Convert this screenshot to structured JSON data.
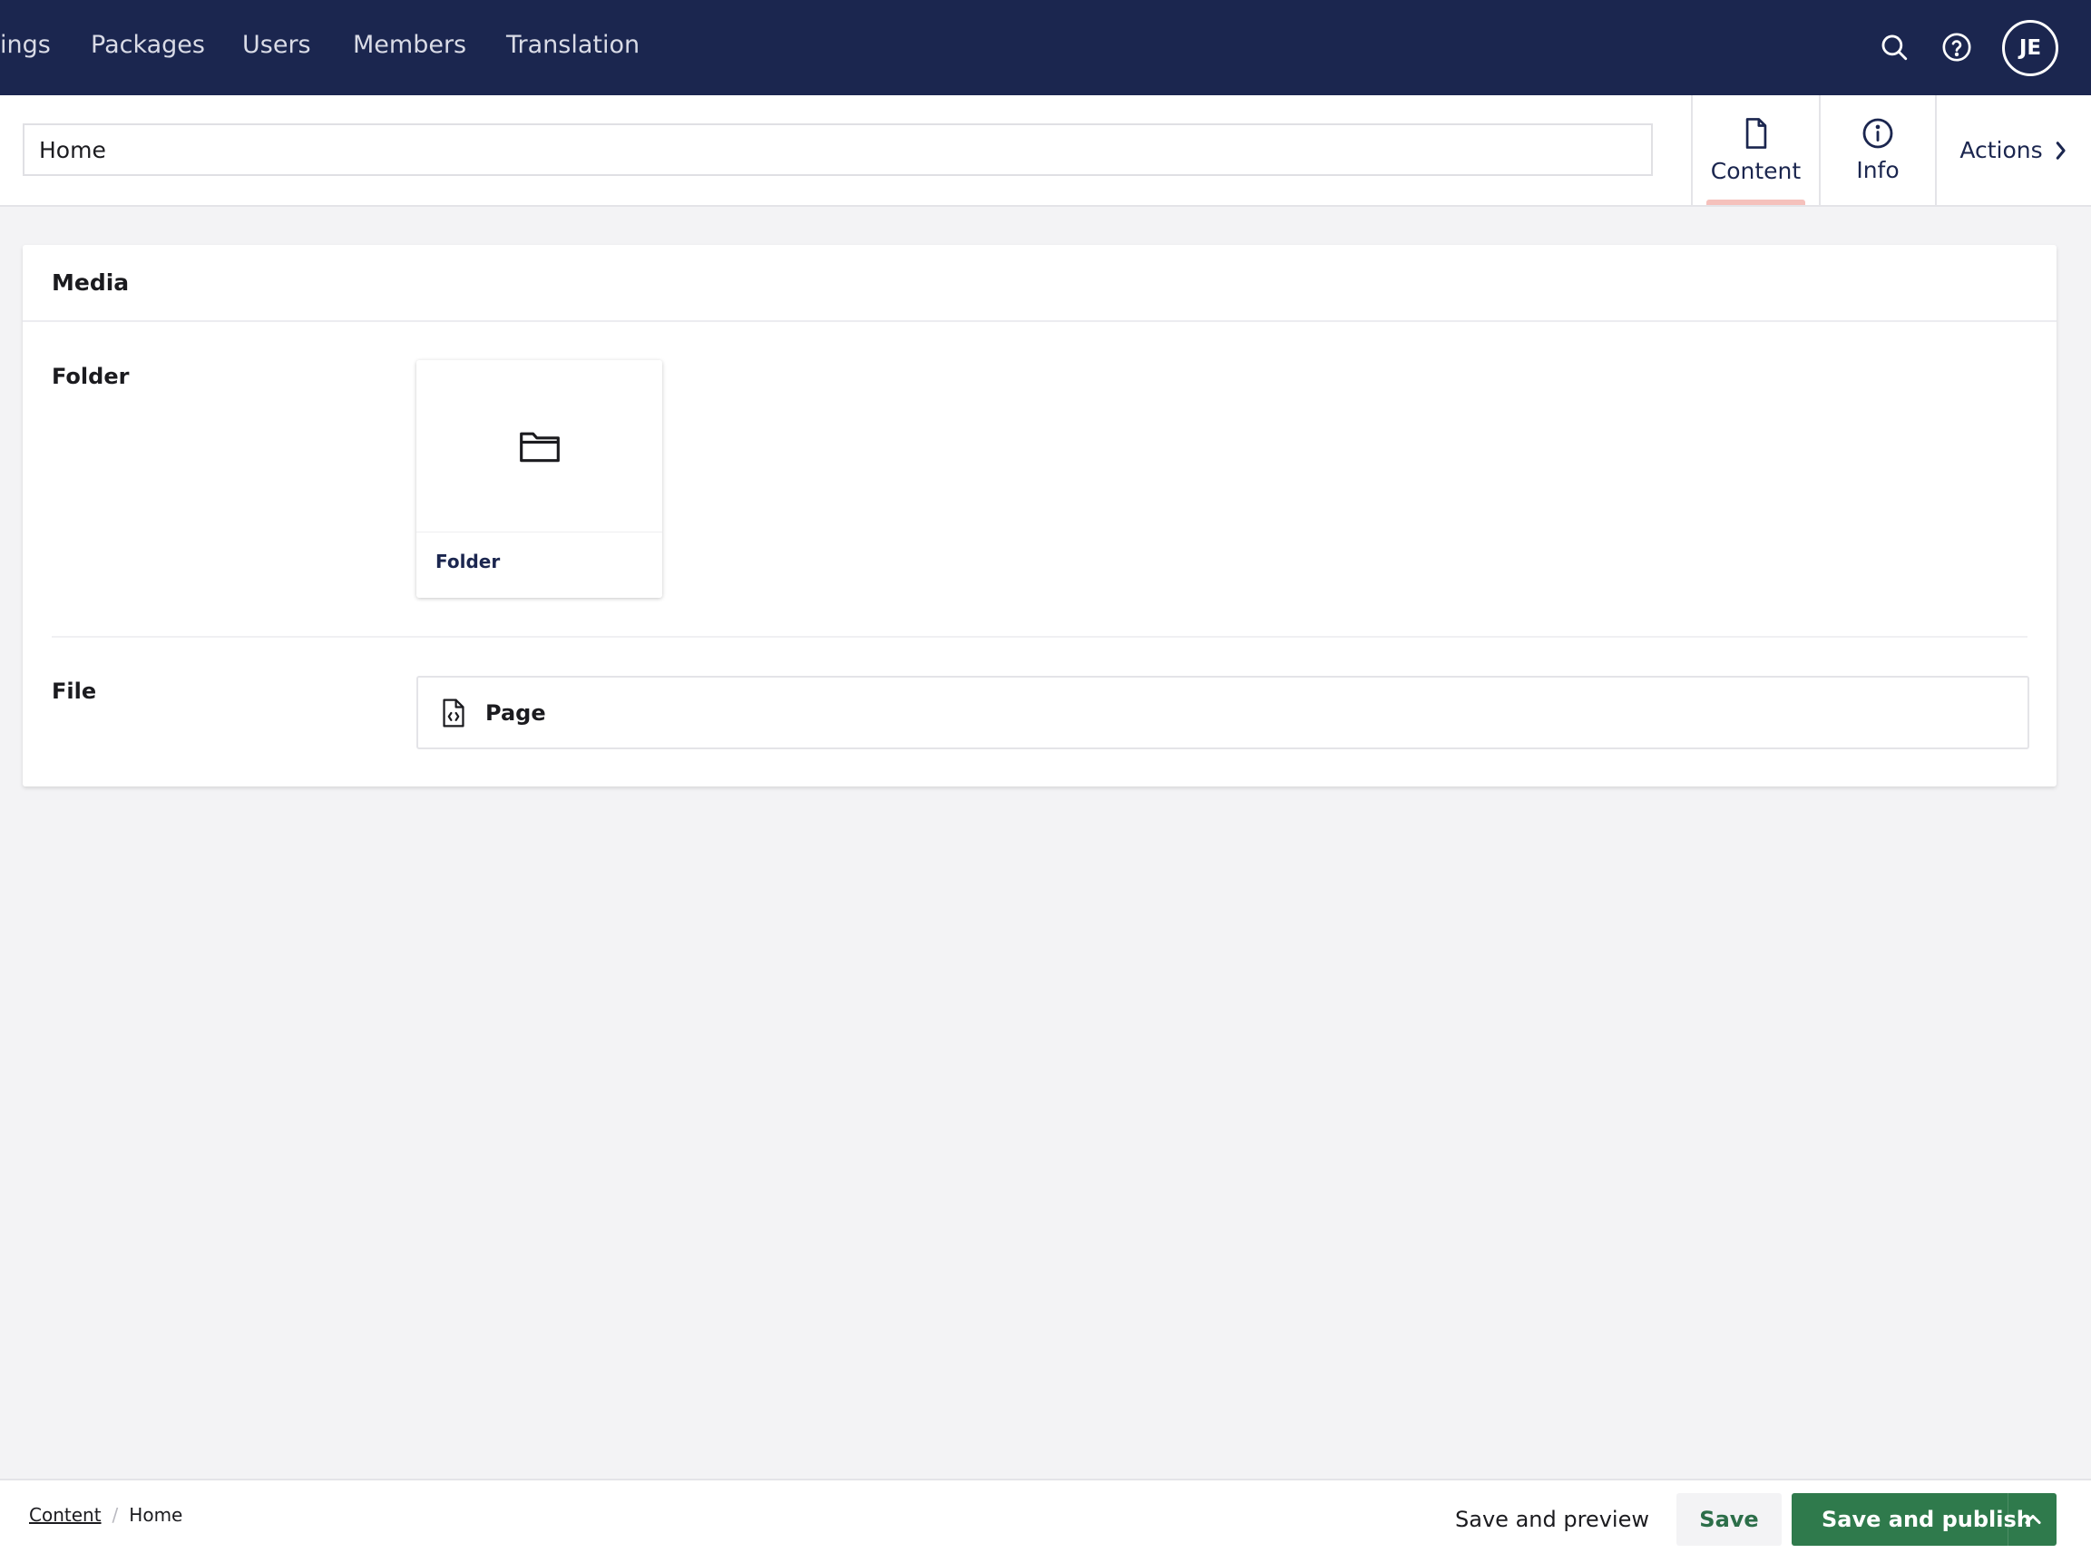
{
  "topnav": {
    "items": [
      {
        "label": "ings"
      },
      {
        "label": "Packages"
      },
      {
        "label": "Users"
      },
      {
        "label": "Members"
      },
      {
        "label": "Translation"
      }
    ],
    "avatar_initials": "JE",
    "icons": [
      "search-icon",
      "help-icon"
    ]
  },
  "header": {
    "name_value": "Home",
    "apps": [
      {
        "label": "Content",
        "icon": "document-icon",
        "active": true
      },
      {
        "label": "Info",
        "icon": "info-icon",
        "active": false
      }
    ],
    "actions_label": "Actions"
  },
  "card": {
    "title": "Media",
    "properties": [
      {
        "label": "Folder"
      },
      {
        "label": "File"
      }
    ],
    "folder_tile": {
      "name": "Folder",
      "icon": "folder-icon"
    },
    "file_item": {
      "name": "Page",
      "icon": "code-file-icon"
    }
  },
  "footer": {
    "breadcrumb": [
      {
        "label": "Content",
        "link": true
      },
      {
        "label": "Home",
        "link": false
      }
    ],
    "buttons": {
      "preview": "Save and preview",
      "save": "Save",
      "publish": "Save and publish"
    }
  },
  "colors": {
    "nav_bg": "#1b264f",
    "publish_green": "#2f7a4c",
    "active_tab_indicator": "#f5c1bc",
    "page_bg": "#f3f3f5"
  }
}
